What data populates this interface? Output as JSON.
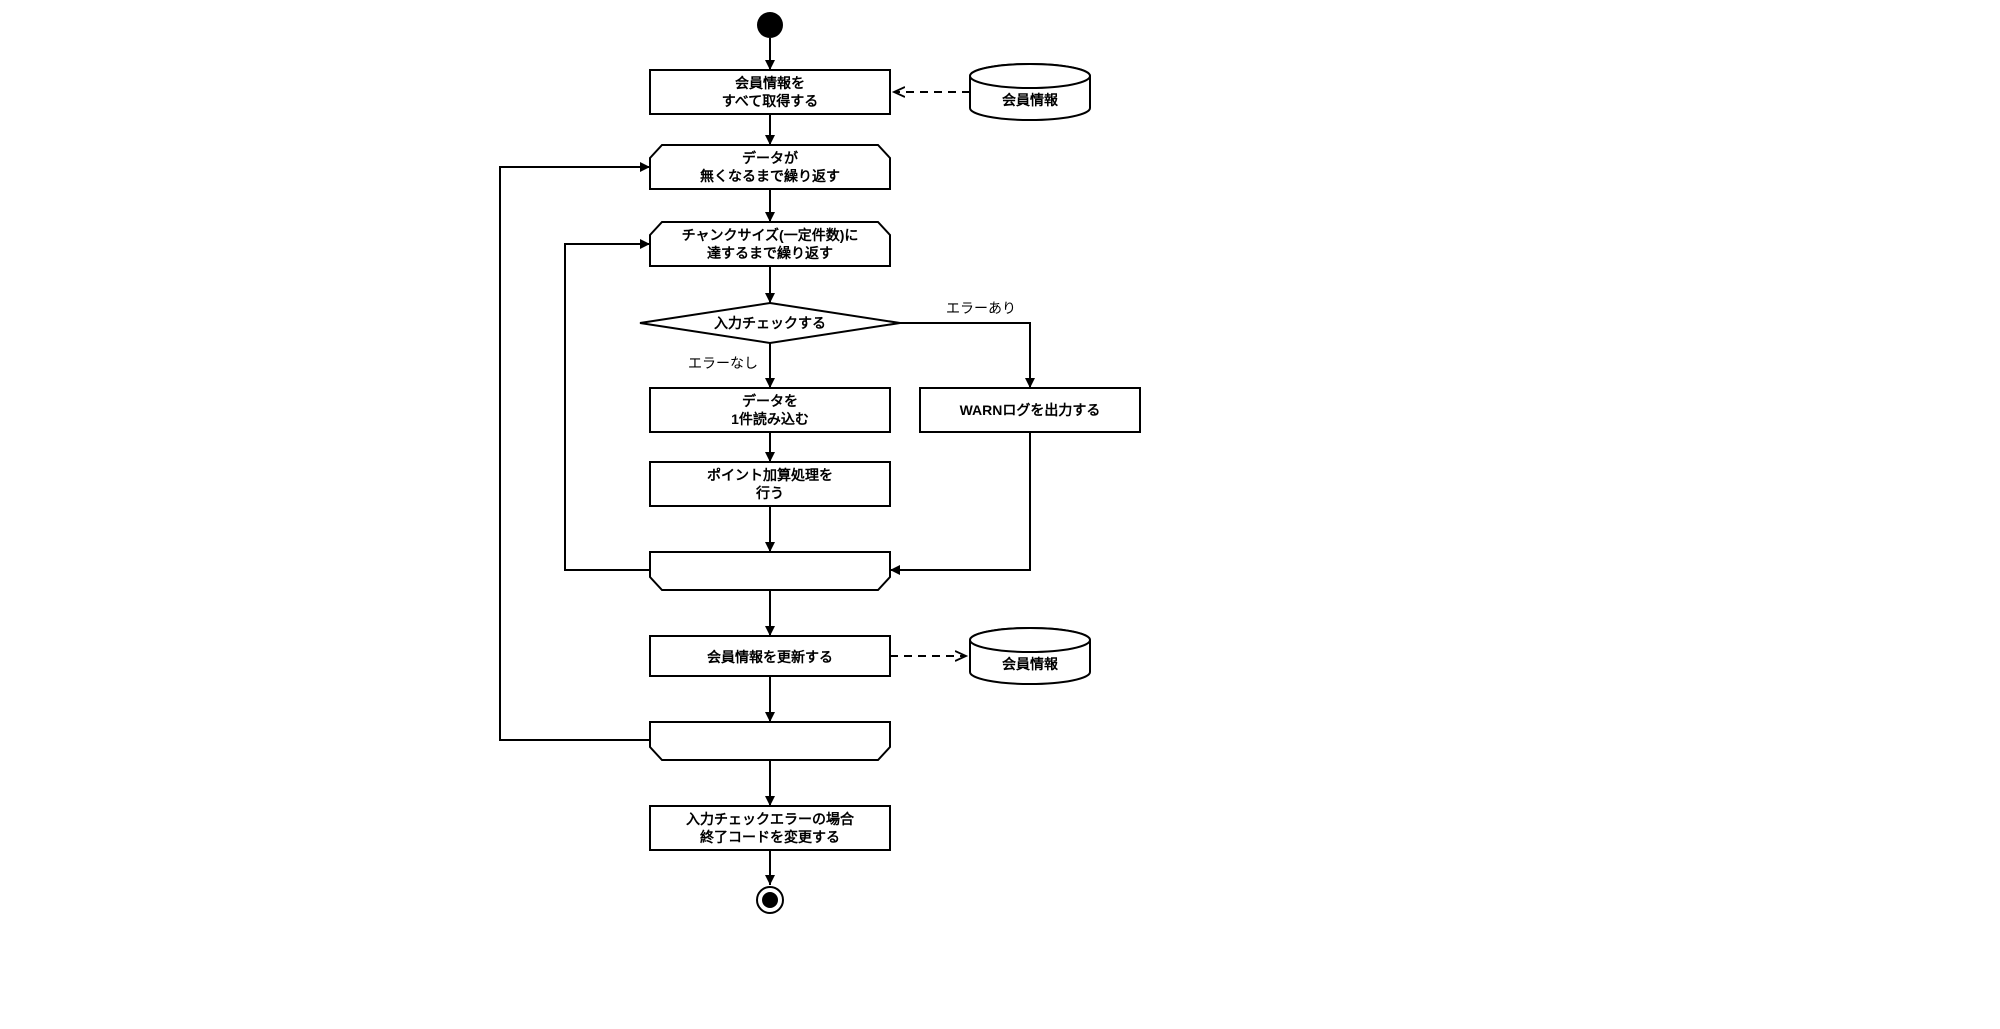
{
  "diagram": {
    "nodes": {
      "fetch_all_line1": "会員情報を",
      "fetch_all_line2": "すべて取得する",
      "db_members": "会員情報",
      "loop_outer_line1": "データが",
      "loop_outer_line2": "無くなるまで繰り返す",
      "loop_inner_line1": "チャンクサイズ(一定件数)に",
      "loop_inner_line2": "達するまで繰り返す",
      "decision": "入力チェックする",
      "decision_yes": "エラーなし",
      "decision_no": "エラーあり",
      "read_one_line1": "データを",
      "read_one_line2": "1件読み込む",
      "add_points_line1": "ポイント加算処理を",
      "add_points_line2": "行う",
      "warn_log": "WARNログを出力する",
      "update_members": "会員情報を更新する",
      "db_members2": "会員情報",
      "final_line1": "入力チェックエラーの場合",
      "final_line2": "終了コードを変更する"
    }
  }
}
